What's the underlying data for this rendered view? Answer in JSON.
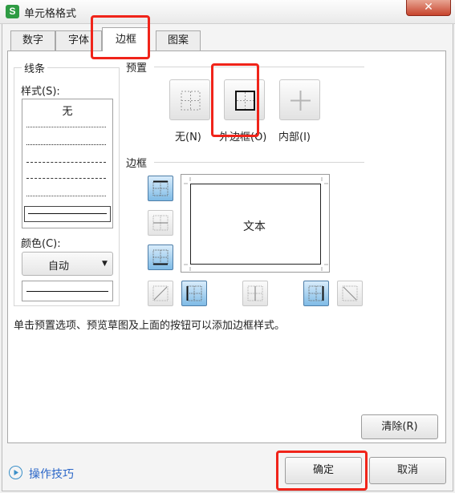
{
  "window": {
    "title": "单元格格式",
    "app_icon_letter": "S",
    "close_glyph": "✕"
  },
  "tabs": [
    {
      "label": "数字",
      "active": false
    },
    {
      "label": "字体",
      "active": false
    },
    {
      "label": "边框",
      "active": true
    },
    {
      "label": "图案",
      "active": false
    }
  ],
  "line_group": {
    "legend": "线条",
    "style_label": "样式(S):",
    "style_none": "无",
    "color_label": "颜色(C):",
    "color_value": "自动",
    "dropdown_arrow": "▼"
  },
  "presets": {
    "section_label": "预置",
    "items": [
      {
        "label": "无(N)",
        "icon": "no-border-icon"
      },
      {
        "label": "外边框(O)",
        "icon": "outline-border-icon"
      },
      {
        "label": "内部(I)",
        "icon": "inside-border-icon"
      }
    ]
  },
  "border": {
    "section_label": "边框",
    "preview_text": "文本"
  },
  "hint": "单击预置选项、预览草图及上面的按钮可以添加边框样式。",
  "buttons": {
    "clear": "清除(R)",
    "ok": "确定",
    "cancel": "取消"
  },
  "footer": {
    "tips_link": "操作技巧"
  },
  "colors": {
    "highlight": "#f0241a",
    "active_toggle": "#7fbbe6",
    "app_icon": "#2e9b43",
    "link": "#2a66c8"
  }
}
